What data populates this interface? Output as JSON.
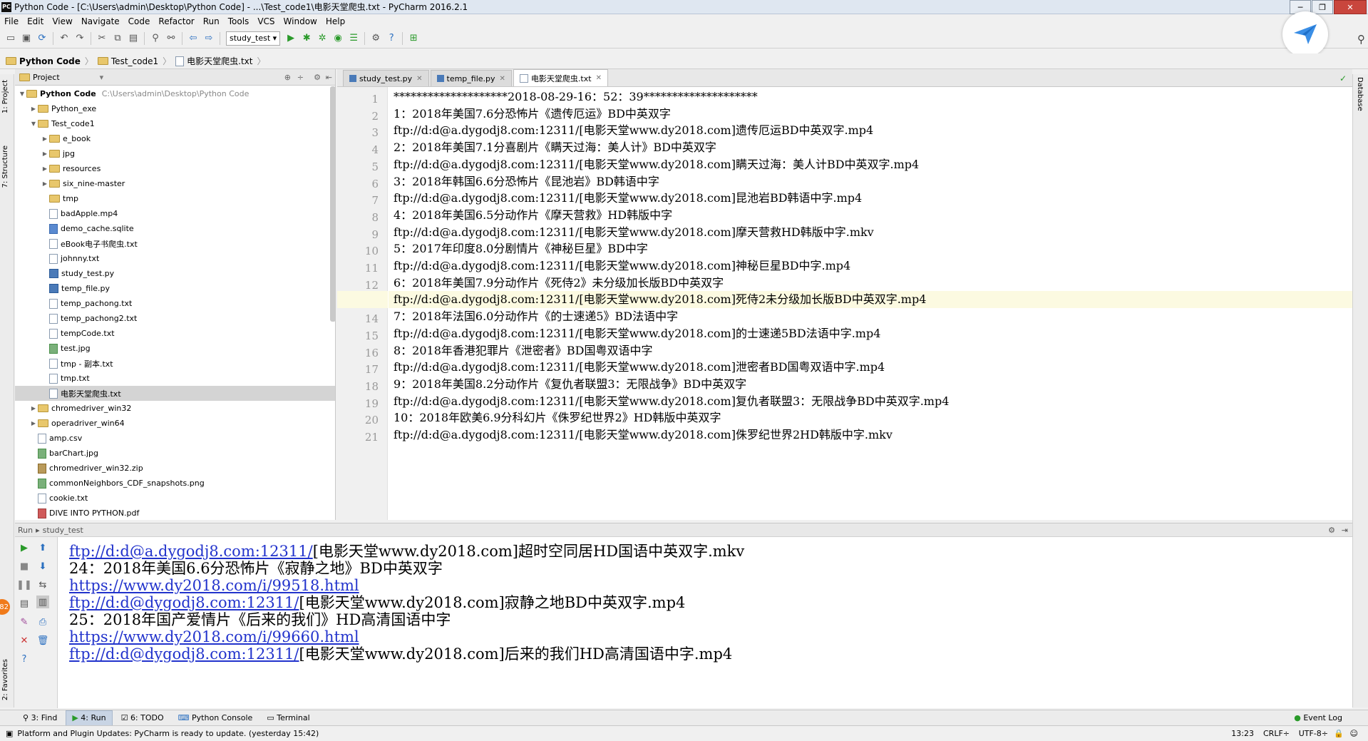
{
  "titlebar": {
    "app_icon": "PC",
    "title": "Python Code - [C:\\Users\\admin\\Desktop\\Python Code] - ...\\Test_code1\\电影天堂爬虫.txt - PyCharm 2016.2.1"
  },
  "menu": [
    "File",
    "Edit",
    "View",
    "Navigate",
    "Code",
    "Refactor",
    "Run",
    "Tools",
    "VCS",
    "Window",
    "Help"
  ],
  "toolbar": {
    "run_config": "study_test"
  },
  "breadcrumb": [
    "Python Code",
    "Test_code1",
    "电影天堂爬虫.txt"
  ],
  "left_strip": {
    "project": "1: Project",
    "structure": "7: Structure",
    "favorites": "2: Favorites"
  },
  "right_strip": {
    "database": "Database"
  },
  "project": {
    "header": "Project",
    "root": {
      "name": "Python Code",
      "path": "C:\\Users\\admin\\Desktop\\Python Code"
    },
    "items": [
      {
        "name": "Python_exe",
        "type": "folder",
        "depth": 1,
        "arrow": "▶"
      },
      {
        "name": "Test_code1",
        "type": "folder",
        "depth": 1,
        "arrow": "▼"
      },
      {
        "name": "e_book",
        "type": "folder",
        "depth": 2,
        "arrow": "▶"
      },
      {
        "name": "jpg",
        "type": "folder",
        "depth": 2,
        "arrow": "▶"
      },
      {
        "name": "resources",
        "type": "folder",
        "depth": 2,
        "arrow": "▶"
      },
      {
        "name": "six_nine-master",
        "type": "folder",
        "depth": 2,
        "arrow": "▶"
      },
      {
        "name": "tmp",
        "type": "folder",
        "depth": 2,
        "arrow": ""
      },
      {
        "name": "badApple.mp4",
        "type": "file",
        "depth": 2,
        "arrow": ""
      },
      {
        "name": "demo_cache.sqlite",
        "type": "db",
        "depth": 2,
        "arrow": ""
      },
      {
        "name": "eBook电子书爬虫.txt",
        "type": "file",
        "depth": 2,
        "arrow": ""
      },
      {
        "name": "johnny.txt",
        "type": "file",
        "depth": 2,
        "arrow": ""
      },
      {
        "name": "study_test.py",
        "type": "py",
        "depth": 2,
        "arrow": ""
      },
      {
        "name": "temp_file.py",
        "type": "py",
        "depth": 2,
        "arrow": ""
      },
      {
        "name": "temp_pachong.txt",
        "type": "file",
        "depth": 2,
        "arrow": ""
      },
      {
        "name": "temp_pachong2.txt",
        "type": "file",
        "depth": 2,
        "arrow": ""
      },
      {
        "name": "tempCode.txt",
        "type": "file",
        "depth": 2,
        "arrow": ""
      },
      {
        "name": "test.jpg",
        "type": "img",
        "depth": 2,
        "arrow": ""
      },
      {
        "name": "tmp - 副本.txt",
        "type": "file",
        "depth": 2,
        "arrow": ""
      },
      {
        "name": "tmp.txt",
        "type": "file",
        "depth": 2,
        "arrow": ""
      },
      {
        "name": "电影天堂爬虫.txt",
        "type": "file",
        "depth": 2,
        "arrow": "",
        "selected": true
      },
      {
        "name": "chromedriver_win32",
        "type": "folder",
        "depth": 1,
        "arrow": "▶"
      },
      {
        "name": "operadriver_win64",
        "type": "folder",
        "depth": 1,
        "arrow": "▶"
      },
      {
        "name": "amp.csv",
        "type": "file",
        "depth": 1,
        "arrow": ""
      },
      {
        "name": "barChart.jpg",
        "type": "img",
        "depth": 1,
        "arrow": ""
      },
      {
        "name": "chromedriver_win32.zip",
        "type": "zip",
        "depth": 1,
        "arrow": ""
      },
      {
        "name": "commonNeighbors_CDF_snapshots.png",
        "type": "img",
        "depth": 1,
        "arrow": ""
      },
      {
        "name": "cookie.txt",
        "type": "file",
        "depth": 1,
        "arrow": ""
      },
      {
        "name": "DIVE INTO PYTHON.pdf",
        "type": "pdf",
        "depth": 1,
        "arrow": ""
      }
    ]
  },
  "editor": {
    "tabs": [
      {
        "label": "study_test.py",
        "kind": "py",
        "active": false
      },
      {
        "label": "temp_file.py",
        "kind": "py",
        "active": false
      },
      {
        "label": "电影天堂爬虫.txt",
        "kind": "txt",
        "active": true
      }
    ],
    "current_line": 13,
    "lines": [
      "********************2018-08-29-16：52：39********************",
      "1：2018年美国7.6分恐怖片《遗传厄运》BD中英双字",
      "ftp://d:d@a.dygodj8.com:12311/[电影天堂www.dy2018.com]遗传厄运BD中英双字.mp4",
      "2：2018年美国7.1分喜剧片《瞒天过海：美人计》BD中英双字",
      "ftp://d:d@a.dygodj8.com:12311/[电影天堂www.dy2018.com]瞒天过海：美人计BD中英双字.mp4",
      "3：2018年韩国6.6分恐怖片《昆池岩》BD韩语中字",
      "ftp://d:d@a.dygodj8.com:12311/[电影天堂www.dy2018.com]昆池岩BD韩语中字.mp4",
      "4：2018年美国6.5分动作片《摩天营救》HD韩版中字",
      "ftp://d:d@a.dygodj8.com:12311/[电影天堂www.dy2018.com]摩天营救HD韩版中字.mkv",
      "5：2017年印度8.0分剧情片《神秘巨星》BD中字",
      "ftp://d:d@a.dygodj8.com:12311/[电影天堂www.dy2018.com]神秘巨星BD中字.mp4",
      "6：2018年美国7.9分动作片《死侍2》未分级加长版BD中英双字",
      "ftp://d:d@a.dygodj8.com:12311/[电影天堂www.dy2018.com]死侍2未分级加长版BD中英双字.mp4",
      "7：2018年法国6.0分动作片《的士速递5》BD法语中字",
      "ftp://d:d@a.dygodj8.com:12311/[电影天堂www.dy2018.com]的士速递5BD法语中字.mp4",
      "8：2018年香港犯罪片《泄密者》BD国粤双语中字",
      "ftp://d:d@a.dygodj8.com:12311/[电影天堂www.dy2018.com]泄密者BD国粤双语中字.mp4",
      "9：2018年美国8.2分动作片《复仇者联盟3：无限战争》BD中英双字",
      "ftp://d:d@a.dygodj8.com:12311/[电影天堂www.dy2018.com]复仇者联盟3：无限战争BD中英双字.mp4",
      "10：2018年欧美6.9分科幻片《侏罗纪世界2》HD韩版中英双字",
      "ftp://d:d@a.dygodj8.com:12311/[电影天堂www.dy2018.com]侏罗纪世界2HD韩版中字.mkv"
    ]
  },
  "run": {
    "label": "Run",
    "config": "study_test",
    "output": [
      {
        "link": "ftp://d:d@a.dygodj8.com:12311/",
        "text": "[电影天堂www.dy2018.com]超时空同居HD国语中英双字.mkv"
      },
      {
        "link": "",
        "text": "24：2018年美国6.6分恐怖片《寂静之地》BD中英双字"
      },
      {
        "link": "https://www.dy2018.com/i/99518.html",
        "text": ""
      },
      {
        "link": "ftp://d:d@dygodj8.com:12311/",
        "text": "[电影天堂www.dy2018.com]寂静之地BD中英双字.mp4"
      },
      {
        "link": "",
        "text": "25：2018年国产爱情片《后来的我们》HD高清国语中字"
      },
      {
        "link": "https://www.dy2018.com/i/99660.html",
        "text": ""
      },
      {
        "link": "ftp://d:d@dygodj8.com:12311/",
        "text": "[电影天堂www.dy2018.com]后来的我们HD高清国语中字.mp4"
      }
    ],
    "badge": "82"
  },
  "bottom_tabs": [
    {
      "label": "3: Find",
      "icon": "search-icon"
    },
    {
      "label": "4: Run",
      "icon": "run-icon",
      "active": true
    },
    {
      "label": "6: TODO",
      "icon": "todo-icon"
    },
    {
      "label": "Python Console",
      "icon": "console-icon"
    },
    {
      "label": "Terminal",
      "icon": "terminal-icon"
    }
  ],
  "event_log": "Event Log",
  "status": {
    "message": "Platform and Plugin Updates: PyCharm is ready to update. (yesterday 15:42)",
    "position": "13:23",
    "line_sep": "CRLF÷",
    "encoding": "UTF-8÷"
  },
  "colors": {
    "link": "#2233cc",
    "current_line": "#fcfae1",
    "accent": "#2a9a2a"
  }
}
